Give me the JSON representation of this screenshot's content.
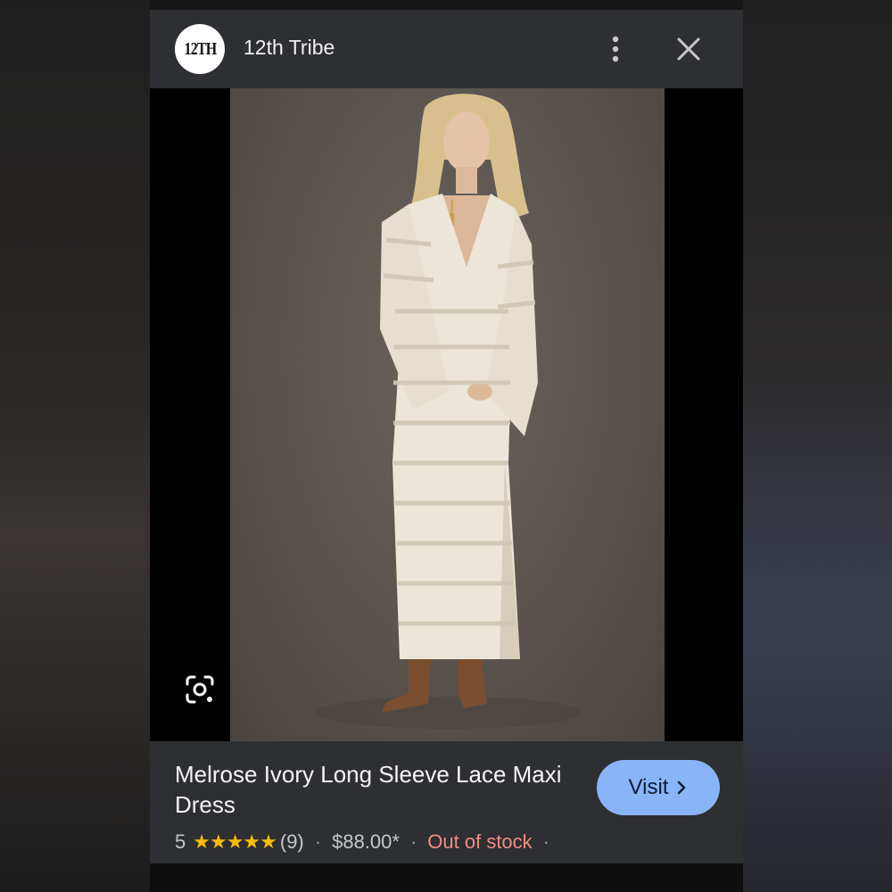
{
  "header": {
    "logo_text": "12TH",
    "brand_name": "12th Tribe",
    "menu_icon": "more-vertical-icon",
    "close_icon": "close-icon"
  },
  "image": {
    "lens_icon": "google-lens-icon"
  },
  "product": {
    "title": "Melrose Ivory Long Sleeve Lace Maxi Dress",
    "rating": "5",
    "stars": "★★★★★",
    "review_count": "(9)",
    "price": "$88.00*",
    "stock_status": "Out of stock",
    "trailing_separator": "·"
  },
  "actions": {
    "visit_label": "Visit"
  },
  "colors": {
    "panel_bg": "#2d2f33",
    "visit_button": "#8ab4f8",
    "star": "#fbbc04",
    "out_of_stock": "#f28b82"
  }
}
